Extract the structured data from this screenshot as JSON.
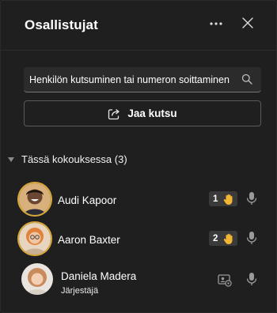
{
  "header": {
    "title": "Osallistujat"
  },
  "search": {
    "placeholder": "Henkilön kutsuminen tai numeron soittaminen"
  },
  "share": {
    "label": "Jaa kutsu"
  },
  "section": {
    "label": "Tässä kokouksessa (3)"
  },
  "participants": [
    {
      "name": "Audi Kapoor",
      "hand_raised_order": "1",
      "mic": "available"
    },
    {
      "name": "Aaron Baxter",
      "hand_raised_order": "2",
      "mic": "available"
    },
    {
      "name": "Daniela Madera",
      "role": "Järjestäjä",
      "mic": "available"
    }
  ],
  "icons": {
    "more": "more-options-icon",
    "close": "close-icon",
    "search": "search-icon",
    "share": "share-icon",
    "section": "chevron-down-icon",
    "hand": "raised-hand-icon",
    "mic": "microphone-icon",
    "organizer": "organizer-badge-icon"
  },
  "colors": {
    "panel_bg": "#1f1f1f",
    "hand_ring": "#d9a83a",
    "hand_emoji": "#f2b632",
    "badge_bg": "#3a3a3a"
  }
}
